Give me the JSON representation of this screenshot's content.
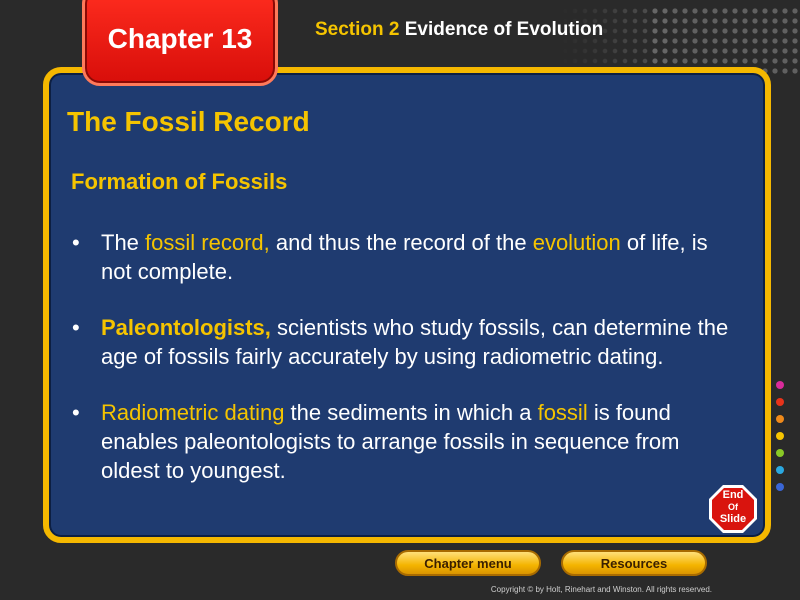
{
  "header": {
    "chapter_label": "Chapter 13",
    "section_number": "Section 2",
    "section_title": " Evidence of Evolution"
  },
  "slide": {
    "title": "The Fossil Record",
    "subtitle": "Formation of Fossils",
    "bullets": [
      {
        "parts": [
          {
            "text": "The ",
            "style": "plain"
          },
          {
            "text": "fossil record,",
            "style": "highlight"
          },
          {
            "text": " and thus the record of the ",
            "style": "plain"
          },
          {
            "text": "evolution",
            "style": "highlight"
          },
          {
            "text": " of life, is not complete.",
            "style": "plain"
          }
        ]
      },
      {
        "parts": [
          {
            "text": "Paleontologists,",
            "style": "highlight-bold"
          },
          {
            "text": " scientists who study fossils, can determine the age of fossils fairly accurately by using radiometric dating.",
            "style": "plain"
          }
        ]
      },
      {
        "parts": [
          {
            "text": "Radiometric dating",
            "style": "highlight"
          },
          {
            "text": " the sediments in which a ",
            "style": "plain"
          },
          {
            "text": "fossil",
            "style": "highlight"
          },
          {
            "text": " is found enables paleontologists to arrange fossils in sequence from oldest to youngest.",
            "style": "plain"
          }
        ]
      }
    ]
  },
  "end_slide": {
    "line1": "End",
    "line2": "Of",
    "line3": "Slide"
  },
  "nav": {
    "chapter_menu_label": "Chapter menu",
    "resources_label": "Resources"
  },
  "footer": {
    "copyright": "Copyright © by Holt, Rinehart and Winston. All rights reserved."
  },
  "colors": {
    "panel_bg": "#1f3b70",
    "panel_border": "#f5b800",
    "highlight_text": "#f5c400",
    "chapter_tab": "#e8150e",
    "side_dots": [
      "#d92b9b",
      "#e8331a",
      "#f08a1a",
      "#f5c400",
      "#8ac926",
      "#2aa8e0",
      "#3a66d6"
    ]
  },
  "icons": {
    "end_slide": "end-of-slide-stop-sign-icon"
  }
}
